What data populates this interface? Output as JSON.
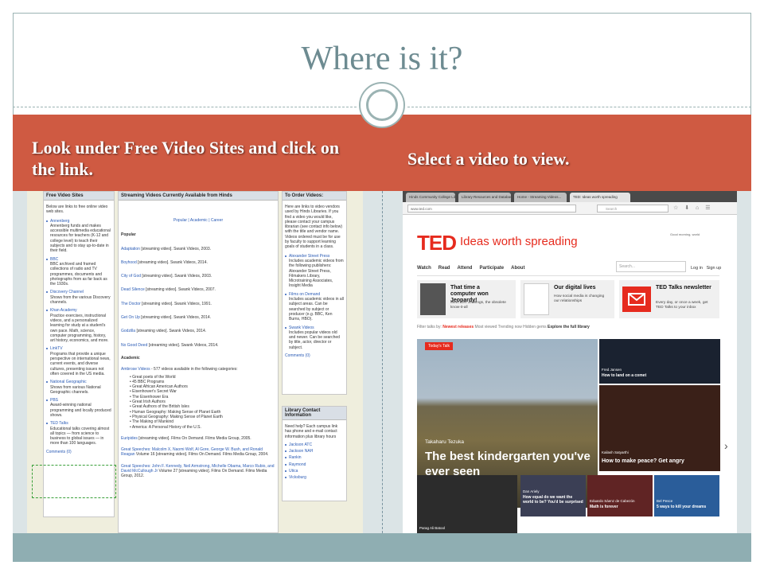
{
  "slide": {
    "title": "Where is it?",
    "left_caption": "Look under Free Video Sites and click on the link.",
    "right_caption": "Select a video to view."
  },
  "left_screenshot": {
    "col1": {
      "header": "Free Video Sites",
      "intro": "Below are links to free online video web sites.",
      "items": [
        {
          "name": "Annenberg",
          "desc": "Annenberg funds and makes accessible multimedia educational resources for teachers (K-12 and college level) to teach their subjects and to stay up-to-date in their field."
        },
        {
          "name": "BBC",
          "desc": "BBC archived and framed collections of radio and TV programmes, documents and photographs from as far back as the 1930s."
        },
        {
          "name": "Discovery Channel",
          "desc": "Shows from the various Discovery channels."
        },
        {
          "name": "Khan Academy",
          "desc": "Practice exercises, instructional videos, and a personalized learning for study at a student's own pace. Math, science, computer programming, history, art history, economics, and more."
        },
        {
          "name": "LinkTV",
          "desc": "Programs that provide a unique perspective on international news, current events, and diverse cultures, presenting issues not often covered in the US media."
        },
        {
          "name": "National Geographic",
          "desc": "Shows from various National Geographic channels."
        },
        {
          "name": "PBS",
          "desc": "Award-winning national programming and locally produced shows."
        },
        {
          "name": "TED Talks",
          "desc": "Educational talks covering almost all topics — from science to business to global issues — in more than 100 languages."
        }
      ],
      "comments": "Comments (0)"
    },
    "col2": {
      "header": "Streaming Videos Currently Available from Hinds",
      "tabs": "Popular | Academic | Career",
      "popular_heading": "Popular",
      "popular": [
        {
          "link": "Adaptation",
          "rest": "[streaming video]. Swank Videos, 2003."
        },
        {
          "link": "Boyhood",
          "rest": "[streaming video]. Swank Videos, 2014."
        },
        {
          "link": "City of God",
          "rest": "[streaming video]. Swank Videos, 2003."
        },
        {
          "link": "Dead Silence",
          "rest": "[streaming video]. Swank Videos, 2007."
        },
        {
          "link": "The Doctor",
          "rest": "[streaming video]. Swank Videos, 1991."
        },
        {
          "link": "Get On Up",
          "rest": "[streaming video]. Swank Videos, 2014."
        },
        {
          "link": "Godzilla",
          "rest": "[streaming video]. Swank Videos, 2014."
        },
        {
          "link": "No Good Deed",
          "rest": "[streaming video]. Swank Videos, 2014."
        }
      ],
      "academic_heading": "Academic",
      "ambrose": {
        "link": "Ambrose Videos",
        "rest": " - 577 videos available in the following categories:"
      },
      "categories": [
        "Great poets of the World",
        "45 BBC Programs",
        "Great African American Authors",
        "Eisenhower's Secret War",
        "The Eisenhower Era",
        "Great Irish Authors",
        "Great Authors of the British Isles",
        "Human Geography: Making Sense of Planet Earth",
        "Physical Geography: Making Sense of Planet Earth",
        "The Making of Mankind",
        "America: A Personal History of the U.S."
      ],
      "entries": [
        {
          "link": "Euripides",
          "rest": " [streaming video]. Films On Demand. Films Media Group, 2005."
        },
        {
          "link": "Great Speeches: Malcolm X, Naomi Wolf, Al Gore, George W. Bush, and Ronald Reagan",
          "rest": " Volume 16 [streaming video]. Films On Demand. Films Media Group, 2004."
        },
        {
          "link": "Great Speeches: John F. Kennedy, Neil Armstrong, Michelle Obama, Marco Rubio, and David McCullough Jr",
          "rest": " Volume 27 [streaming video]. Films On Demand. Films Media Group, 2012."
        }
      ]
    },
    "col3": {
      "header": "To Order Videos:",
      "intro": "Here are links to video vendors used by Hinds Libraries. If you find a video you would like, please contact your campus librarian (see contact info below) with the title and vendor name. Videos ordered must be for use by faculty to support learning goals of students in a class.",
      "vendors": [
        {
          "name": "Alexander Street Press",
          "desc": "Includes academic videos from the following publishers: Alexander Street Press, Filmakers Library, Microtraining Associates, Insight Media"
        },
        {
          "name": "Films on Demand",
          "desc": "Includes academic videos in all subject areas. Can be searched by subject or producer (e.g. BBC, Ken Burns, HBO)."
        },
        {
          "name": "Swank Videos",
          "desc": "Includes popular videos old and newer. Can be searched by title, actor, director or subject."
        }
      ],
      "comments": "Comments (0)",
      "contact_header": "Library Contact Information",
      "contact_intro": "Need help? Each campus link has phone and e-mail contact information plus library hours",
      "campuses": [
        "Jackson ATC",
        "Jackson NAH",
        "Rankin",
        "Raymond",
        "Utica",
        "Vicksburg"
      ]
    }
  },
  "right_screenshot": {
    "tabs": [
      "Hinds Community College Libr...",
      "Library Resources and Database",
      "Home - Streaming Videos...",
      "TED: Ideas worth spreading"
    ],
    "url": "www.ted.com",
    "search_placeholder": "Search",
    "brand": "TED",
    "tagline": "Ideas worth spreading",
    "top_small": "Good morning, world",
    "nav": [
      "Watch",
      "Read",
      "Attend",
      "Participate",
      "About"
    ],
    "site_search_placeholder": "Search...",
    "login": "Log in",
    "signup": "Sign up",
    "promos": [
      {
        "title": "That time a computer won Jeopardy!",
        "sub": "Meet Ken Jennings, the obsolete know-it-all"
      },
      {
        "title": "Our digital lives",
        "sub": "How social media is changing our relationships"
      },
      {
        "title": "TED Talks newsletter",
        "sub": "Every day, or once a week, get TED Talks to your inbox"
      }
    ],
    "filter_label": "Filter talks by:",
    "filters": [
      "Newest releases",
      "Most viewed",
      "Trending now",
      "Hidden gems",
      "Explore the full library"
    ],
    "hero": {
      "tag": "Today's Talk",
      "speaker": "Takaharu Tezuka",
      "title": "The best kindergarten you've ever seen"
    },
    "tiles": [
      {
        "speaker": "Fred Jansen",
        "title": "How to land on a comet"
      },
      {
        "speaker": "Kailash Satyarthi",
        "title": "How to make peace? Get angry"
      },
      {
        "speaker": "Dan Ariely",
        "title": "How equal do we want the world to be? You'd be surprised"
      },
      {
        "speaker": "Eduardo Sáenz de Cabezón",
        "title": "Math is forever"
      },
      {
        "speaker": "Bel Pesce",
        "title": "5 ways to kill your dreams"
      },
      {
        "speaker": "Parag Ali Batool",
        "title": ""
      }
    ]
  }
}
